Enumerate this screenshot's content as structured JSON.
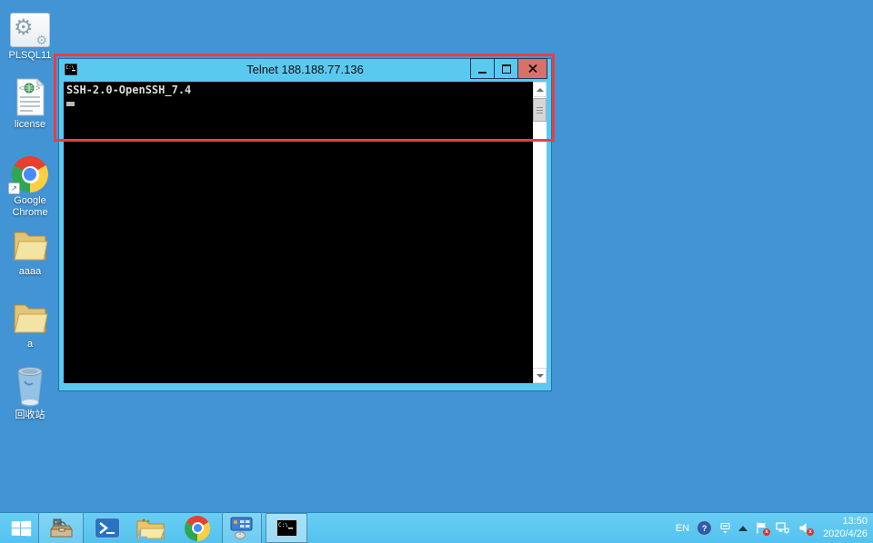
{
  "desktop": {
    "icons": [
      {
        "label": "PLSQL11"
      },
      {
        "label": "license"
      },
      {
        "label": "Google Chrome"
      },
      {
        "label": "aaaa"
      },
      {
        "label": "a"
      },
      {
        "label": "回收站"
      }
    ]
  },
  "telnet_window": {
    "title": "Telnet 188.188.77.136",
    "terminal_line1": "SSH-2.0-OpenSSH_7.4"
  },
  "annotation": {
    "shape": "rectangle",
    "color": "#e8403c"
  },
  "icons": {
    "cmd_glyph": "C:\\",
    "badge_x": "x"
  },
  "taskbar": {
    "tray": {
      "language": "EN",
      "help_glyph": "?",
      "time": "13:50",
      "date": "2020/4/26"
    }
  },
  "colors": {
    "desktop_bg": "#4294d5",
    "taskbar_bg": "#5fcaf0",
    "window_frame": "#5ac9f0",
    "close_button_bg": "#d9716b",
    "terminal_bg": "#000000",
    "terminal_text": "#dcdcdc"
  }
}
